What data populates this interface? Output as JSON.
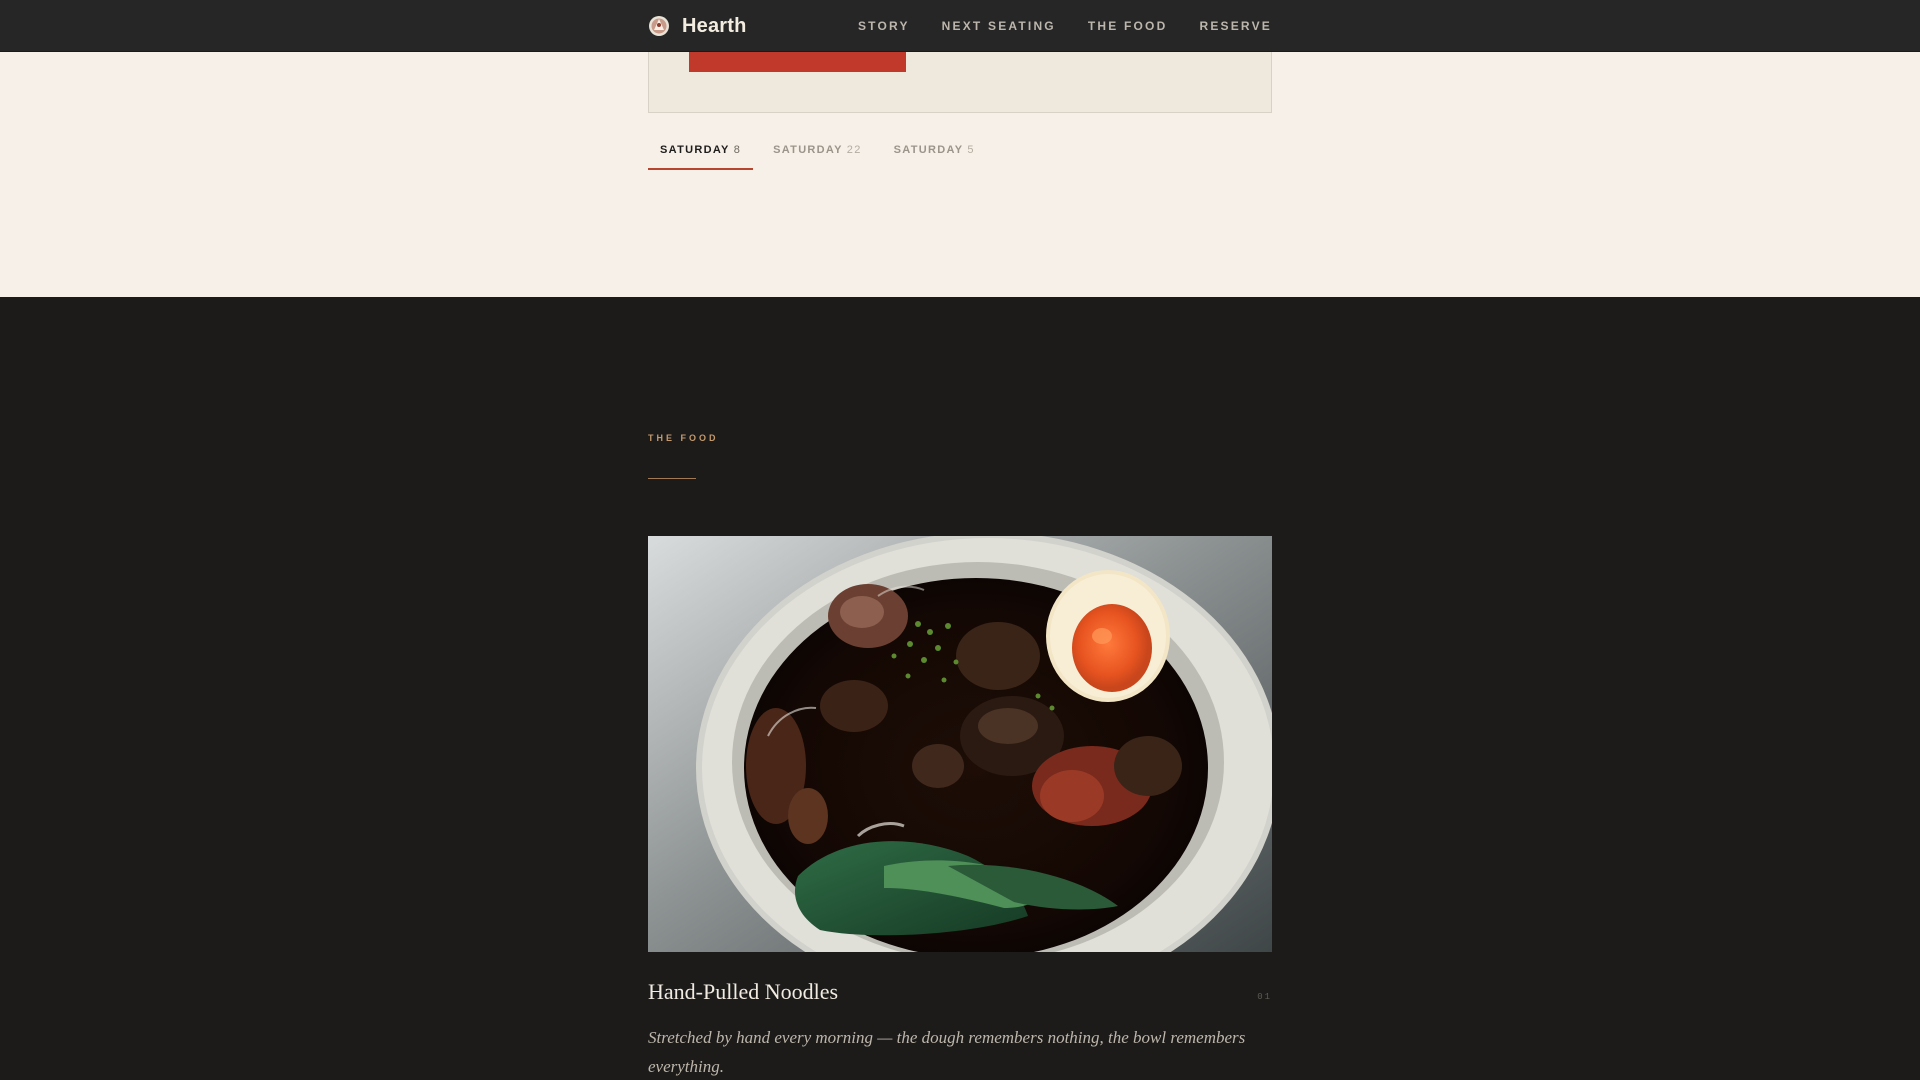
{
  "brand": {
    "name": "Hearth",
    "logo_icon": "hearth-logo-icon"
  },
  "nav": {
    "links": [
      {
        "label": "STORY"
      },
      {
        "label": "NEXT SEATING"
      },
      {
        "label": "THE FOOD"
      },
      {
        "label": "RESERVE"
      }
    ]
  },
  "dates": {
    "tabs": [
      {
        "day": "SATURDAY",
        "num": "8",
        "active": true
      },
      {
        "day": "SATURDAY",
        "num": "22",
        "active": false
      },
      {
        "day": "SATURDAY",
        "num": "5",
        "active": false
      }
    ]
  },
  "food": {
    "eyebrow": "THE FOOD",
    "dishes": [
      {
        "name": "Hand-Pulled Noodles",
        "index": "01",
        "description": "Stretched by hand every morning — the dough remembers nothing, the bowl remembers everything."
      }
    ]
  },
  "colors": {
    "nav_bg": "#262626",
    "cream_bg": "#f6f0e8",
    "dark_bg": "#1c1b1a",
    "accent_red": "#c0392b",
    "accent_gold": "#c49a6c"
  }
}
